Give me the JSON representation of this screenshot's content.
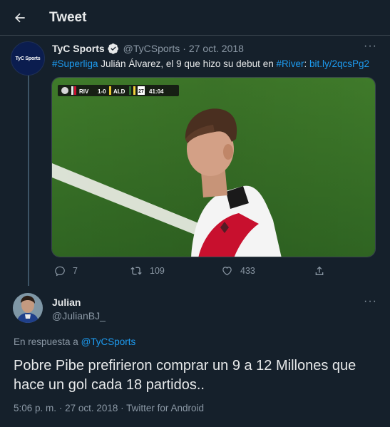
{
  "header": {
    "title": "Tweet"
  },
  "original_tweet": {
    "avatar_text": "TyC Sports",
    "name": "TyC Sports",
    "handle": "@TyCSports",
    "separator": "·",
    "date": "27 oct. 2018",
    "text_parts": {
      "hashtag1": "#Superliga",
      "body": " Julián Álvarez, el 9 que hizo su debut en ",
      "hashtag2": "#River",
      "colon": ": ",
      "link": "bit.ly/2qcsPg2"
    },
    "media": {
      "scoreboard": {
        "home": "RIV",
        "score": "1-0",
        "away": "ALD",
        "num": "27",
        "time": "41:04"
      }
    },
    "actions": {
      "replies": "7",
      "retweets": "109",
      "likes": "433"
    },
    "more_icon": "more-horizontal-icon"
  },
  "reply_tweet": {
    "name": "Julian",
    "handle": "@JulianBJ_",
    "reply_prefix": "En respuesta a ",
    "reply_target": "@TyCSports",
    "text": "Pobre Pibe prefirieron comprar un 9 a 12 Millones que hace un gol cada 18 partidos..",
    "time": "5:06 p. m.",
    "date": "27 oct. 2018",
    "source": "Twitter for Android",
    "separator": "·"
  },
  "colors": {
    "background": "#15202b",
    "accent": "#1d9bf0",
    "muted": "#8b98a5",
    "text": "#e7e9ea"
  }
}
